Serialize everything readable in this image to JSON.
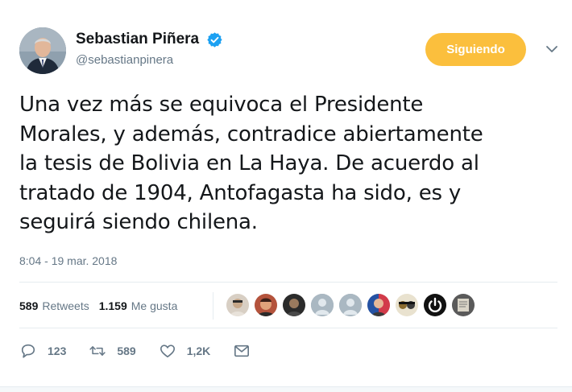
{
  "user": {
    "display_name": "Sebastian Piñera",
    "handle": "@sebastianpinera",
    "verified": true,
    "avatar_icon": "user-avatar"
  },
  "follow_button": {
    "label": "Siguiendo",
    "color": "#fbbf3d"
  },
  "menu": {
    "icon": "chevron-down-icon"
  },
  "tweet": {
    "lines": [
      "Una vez más se equivoca el Presidente",
      "Morales, y además, contradice abiertamente",
      "la tesis de Bolivia en La Haya. De acuerdo al",
      "tratado de 1904, Antofagasta ha sido, es y",
      "seguirá siendo chilena."
    ],
    "timestamp": "8:04 - 19 mar. 2018"
  },
  "stats": {
    "retweets_count": "589",
    "retweets_label": "Retweets",
    "likes_count": "1.159",
    "likes_label": "Me gusta"
  },
  "liker_avatars": [
    {
      "icon": "liker-avatar",
      "color": "#c7a88a"
    },
    {
      "icon": "liker-avatar",
      "color": "#b4533c"
    },
    {
      "icon": "liker-avatar",
      "color": "#2b2b2b"
    },
    {
      "icon": "default-egg-avatar",
      "color": "#aab8c2"
    },
    {
      "icon": "default-egg-avatar",
      "color": "#aab8c2"
    },
    {
      "icon": "liker-avatar",
      "color": "#d23b4a"
    },
    {
      "icon": "liker-avatar",
      "color": "#8a6b2e"
    },
    {
      "icon": "power-logo-avatar",
      "color": "#111111"
    },
    {
      "icon": "liker-avatar",
      "color": "#5a5a5a"
    }
  ],
  "actions": {
    "reply_count": "123",
    "retweet_count": "589",
    "like_count": "1,2K",
    "reply_icon": "reply-icon",
    "retweet_icon": "retweet-icon",
    "like_icon": "heart-icon",
    "dm_icon": "envelope-icon"
  },
  "colors": {
    "text": "#14171a",
    "secondary": "#657786",
    "verified": "#1da1f2",
    "divider": "#e6ecf0"
  }
}
